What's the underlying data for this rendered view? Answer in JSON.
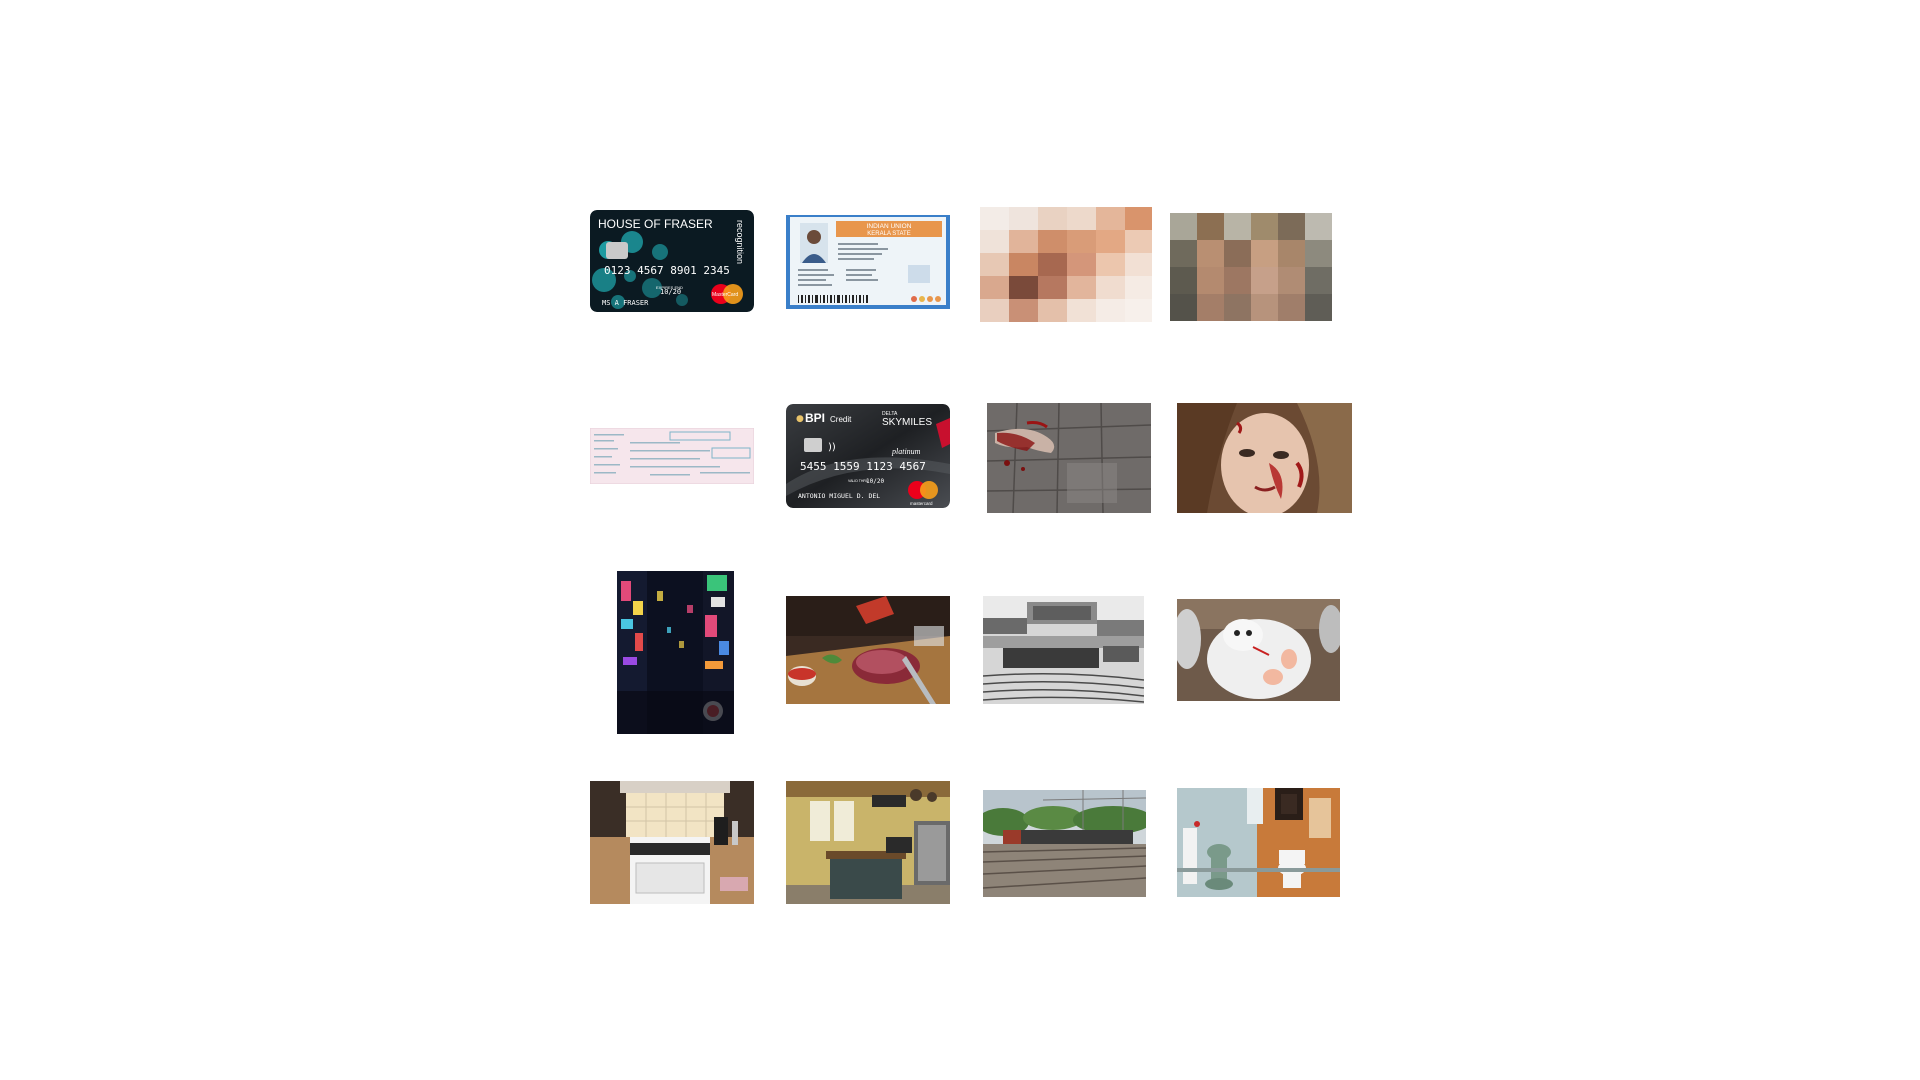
{
  "card_fraser": {
    "brand": "HOUSE OF FRASER",
    "tier": "recognition",
    "number": "0123 4567 8901 2345",
    "expires_label": "EXPIRES END",
    "expiry": "10/20",
    "holder": "MS A FRASER",
    "network": "MasterCard"
  },
  "id_card": {
    "line1": "INDIAN UNION",
    "line2": "KERALA STATE"
  },
  "card_bpi": {
    "brand": "BPI",
    "brand_suffix": "Credit",
    "partner": "DELTA",
    "program": "SKYMILES",
    "tier": "platinum",
    "number": "5455 1559 1123 4567",
    "valid_label": "VALID THRU",
    "expiry": "10/20",
    "holder": "ANTONIO MIGUEL D. DEL",
    "network": "mastercard"
  },
  "colors": {
    "page_bg": "#ffffff",
    "fraser_card": "#0b1a22",
    "fraser_dots": "#1d9aa0",
    "bpi_card": "#2b2d30",
    "id_orange": "#e8964c",
    "id_blue": "#3a7fc9",
    "mastercard_red": "#eb001b",
    "mastercard_orange": "#f79e1b"
  }
}
